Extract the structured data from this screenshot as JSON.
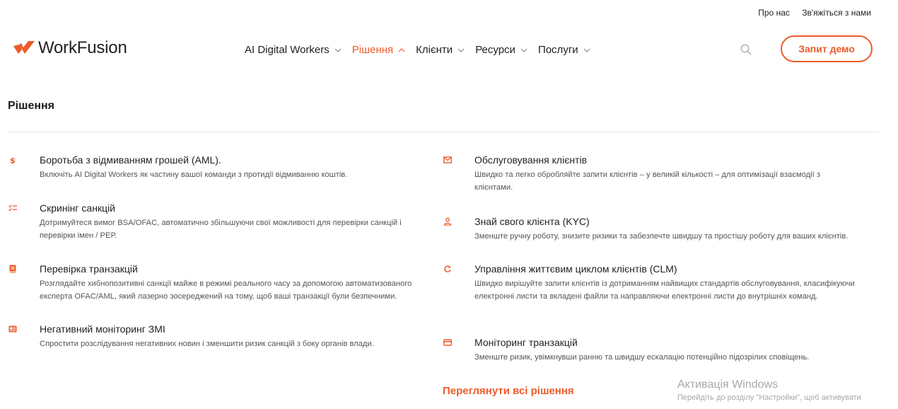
{
  "topbar": {
    "about": "Про нас",
    "contact": "Зв'яжіться з нами"
  },
  "brand": {
    "name": "WorkFusion",
    "accent": "#ec5b2b"
  },
  "nav": {
    "items": [
      {
        "label": "AI Digital Workers"
      },
      {
        "label": "Рішення",
        "active": true
      },
      {
        "label": "Клієнти"
      },
      {
        "label": "Ресурси"
      },
      {
        "label": "Послуги"
      }
    ]
  },
  "header": {
    "cta_label": "Запит демо",
    "search_icon": "search-icon"
  },
  "section": {
    "title": "Рішення"
  },
  "solutions_left": [
    {
      "icon": "dollar-icon",
      "title": "Боротьба з відмиванням грошей (AML).",
      "desc": "Включіть AI Digital Workers як частину вашої команди з протидії відмиванню коштів."
    },
    {
      "icon": "checklist-icon",
      "title": "Скринінг санкцій",
      "desc": "Дотримуйтеся вимог BSA/OFAC, автоматично збільшуючи свої можливості для перевірки санкцій і перевірки імен / PEP."
    },
    {
      "icon": "book-icon",
      "title": "Перевірка транзакцій",
      "desc": "Розглядайте хибнопозитивні санкції майже в режимі реального часу за допомогою автоматизованого експерта OFAC/AML, який лазерно зосереджений на тому, щоб ваші транзакції були безпечними."
    },
    {
      "icon": "newspaper-icon",
      "title": "Негативний моніторинг ЗМІ",
      "desc": "Спростити розслідування негативних новин і зменшити ризик санкцій з боку органів влади."
    }
  ],
  "solutions_right": [
    {
      "icon": "envelope-icon",
      "title": "Обслуговування клієнтів",
      "desc": "Швидко та легко обробляйте запити клієнтів – у великій кількості – для оптимізації взаємодії з клієнтами."
    },
    {
      "icon": "person-icon",
      "title": "Знай свого клієнта (KYC)",
      "desc": "Зменште ручну роботу, знизите ризики та забезпечте швидшу та простішу роботу для ваших клієнтів."
    },
    {
      "icon": "cycle-icon",
      "title": "Управління життєвим циклом клієнтів (CLM)",
      "desc": "Швидко вирішуйте запити клієнтів із дотриманням найвищих стандартів обслуговування, класифікуючи електронні листи та вкладені файли та направляючи електронні листи до внутрішніх команд."
    },
    {
      "icon": "card-icon",
      "title": "Моніторинг транзакцій",
      "desc": "Зменште ризик, увімкнувши ранню та швидшу ескалацію потенційно підозрілих сповіщень."
    }
  ],
  "view_all": "Переглянути всі рішення",
  "watermark": {
    "title": "Активація Windows",
    "subtitle": "Перейдіть до розділу \"Настройки\", щоб активувати"
  }
}
